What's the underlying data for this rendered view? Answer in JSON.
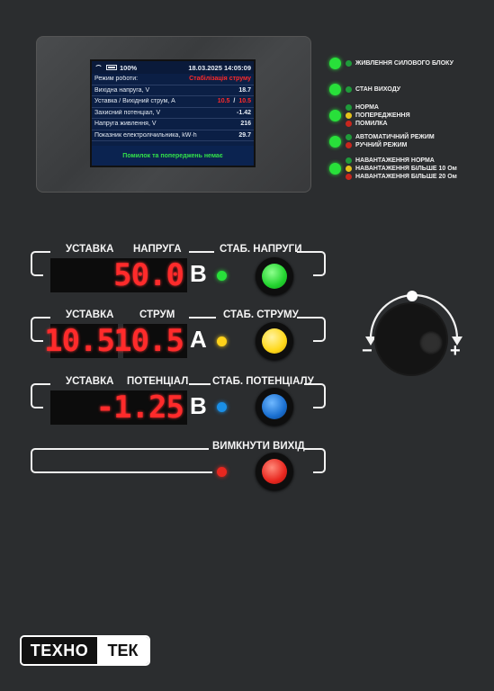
{
  "lcd": {
    "battery": "100%",
    "datetime": "18.03.2025 14:05:09",
    "rows": [
      {
        "label": "Режим роботи:",
        "value": "Стабілізація струму"
      },
      {
        "label": "Вихідна напруга, V",
        "value": "18.7"
      },
      {
        "label": "Уставка / Вихідний струм, А",
        "value_a": "10.5",
        "sep": "/",
        "value_b": "10.5"
      },
      {
        "label": "Захисний потенціал, V",
        "value": "-1.42"
      },
      {
        "label": "Напруга живлення, V",
        "value": "216"
      },
      {
        "label": "Показник електролічильника, kW·h",
        "value": "29.7"
      }
    ],
    "footer": "Помилок та попереджень немає"
  },
  "indicators": [
    {
      "lines": [
        "ЖИВЛЕННЯ СИЛОВОГО БЛОКУ"
      ]
    },
    {
      "lines": [
        "СТАН ВИХОДУ"
      ]
    },
    {
      "lines": [
        "НОРМА",
        "ПОПЕРЕДЖЕННЯ",
        "ПОМИЛКА"
      ]
    },
    {
      "lines": [
        "АВТОМАТИЧНИЙ РЕЖИМ",
        "РУЧНИЙ РЕЖИМ"
      ]
    },
    {
      "lines": [
        "НАВАНТАЖЕННЯ НОРМА",
        "НАВАНТАЖЕННЯ БІЛЬШЕ 10 Ом",
        "НАВАНТАЖЕННЯ БІЛЬШЕ 20 Ом"
      ]
    }
  ],
  "rows": {
    "voltage": {
      "label_a": "УСТАВКА",
      "label_b": "НАПРУГА",
      "display": "50.0",
      "unit": "В",
      "button_label": "СТАБ. НАПРУГИ"
    },
    "current": {
      "label_a": "УСТАВКА",
      "label_b": "СТРУМ",
      "display_a": "10.5",
      "display_b": "10.5",
      "unit": "А",
      "button_label": "СТАБ. СТРУМУ"
    },
    "potential": {
      "label_a": "УСТАВКА",
      "label_b": "ПОТЕНЦІАЛ",
      "display": "-1.25",
      "unit": "В",
      "button_label": "СТАБ. ПОТЕНЦІАЛУ"
    },
    "off": {
      "button_label": "ВИМКНУТИ ВИХІД"
    }
  },
  "knob": {
    "minus": "−",
    "plus": "+"
  },
  "logo": {
    "left": "ТЕХНО",
    "right": "ТЕК"
  },
  "colors": {
    "green": "#28e03a",
    "yellow": "#ffd21a",
    "red": "#e8271f",
    "blue": "#1a7fd6"
  }
}
